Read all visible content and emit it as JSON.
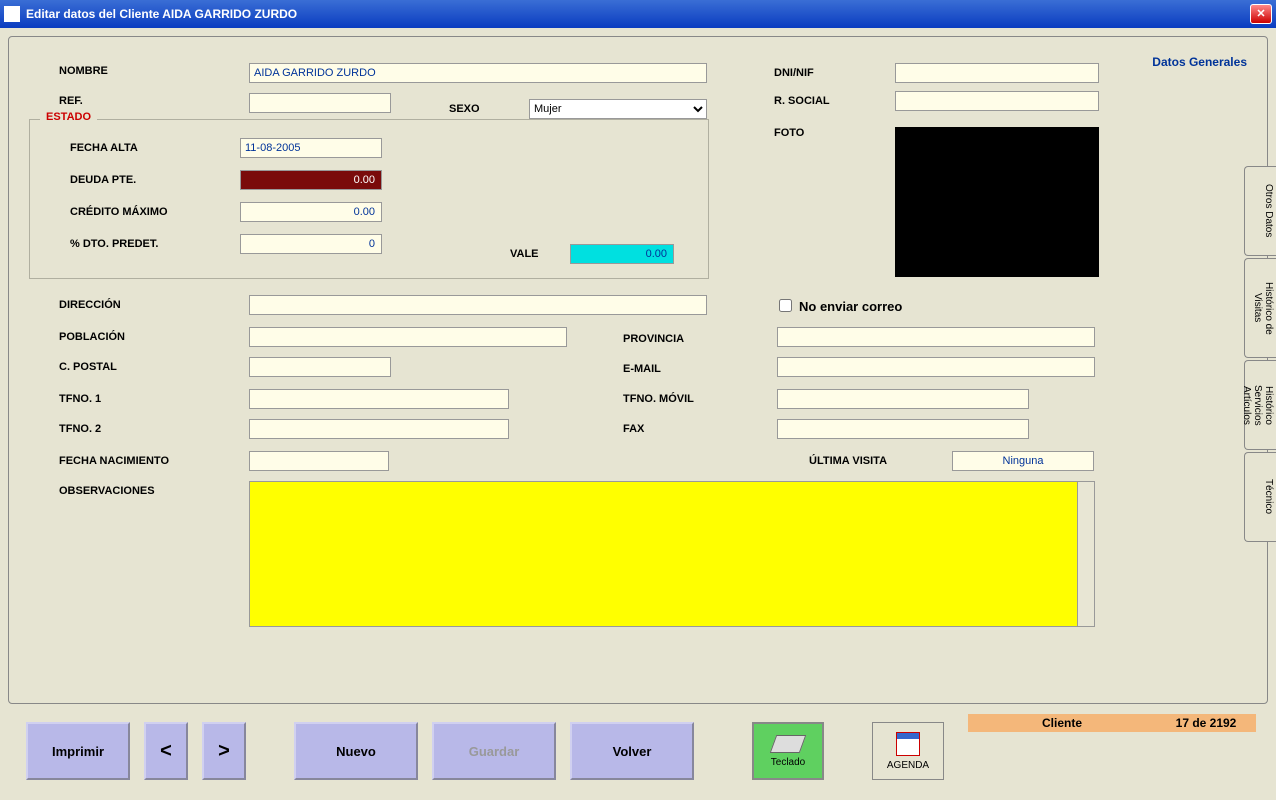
{
  "titlebar": {
    "text": "Editar datos del Cliente AIDA GARRIDO ZURDO"
  },
  "header": {
    "datos_generales": "Datos Generales"
  },
  "labels": {
    "nombre": "NOMBRE",
    "ref": "REF.",
    "sexo": "SEXO",
    "dni": "DNI/NIF",
    "rsocial": "R. SOCIAL",
    "foto": "FOTO",
    "estado": "ESTADO",
    "fecha_alta": "FECHA ALTA",
    "deuda": "DEUDA PTE.",
    "credito": "CRÉDITO MÁXIMO",
    "dto": "% DTO. PREDET.",
    "vale": "VALE",
    "direccion": "DIRECCIÓN",
    "no_enviar": "No enviar correo",
    "poblacion": "POBLACIÓN",
    "provincia": "PROVINCIA",
    "cpostal": "C. POSTAL",
    "email": "E-MAIL",
    "tfno1": "TFNO. 1",
    "tfnomovil": "TFNO. MÓVIL",
    "tfno2": "TFNO. 2",
    "fax": "FAX",
    "fnac": "FECHA NACIMIENTO",
    "ultima_visita": "ÚLTIMA VISITA",
    "observaciones": "OBSERVACIONES"
  },
  "values": {
    "nombre": "AIDA GARRIDO ZURDO",
    "ref": "",
    "sexo": "Mujer",
    "dni": "",
    "rsocial": "",
    "fecha_alta": "11-08-2005",
    "deuda": "0.00",
    "credito": "0.00",
    "dto": "0",
    "vale": "0.00",
    "direccion": "",
    "no_enviar_checked": false,
    "poblacion": "",
    "provincia": "",
    "cpostal": "",
    "email": "",
    "tfno1": "",
    "tfnomovil": "",
    "tfno2": "",
    "fax": "",
    "fnac": "",
    "ultima_visita": "Ninguna",
    "observaciones": ""
  },
  "sexo_options": [
    "Mujer"
  ],
  "side_tabs": {
    "otros_datos": "Otros Datos",
    "historico_visitas": "Histórico de Visitas",
    "historico_servicios": "Histórico Servicios Artículos",
    "tecnico": "Técnico"
  },
  "buttons": {
    "imprimir": "Imprimir",
    "prev": "<",
    "next": ">",
    "nuevo": "Nuevo",
    "guardar": "Guardar",
    "volver": "Volver",
    "teclado": "Teclado",
    "agenda": "AGENDA"
  },
  "status": {
    "label": "Cliente",
    "count": "17 de 2192"
  }
}
